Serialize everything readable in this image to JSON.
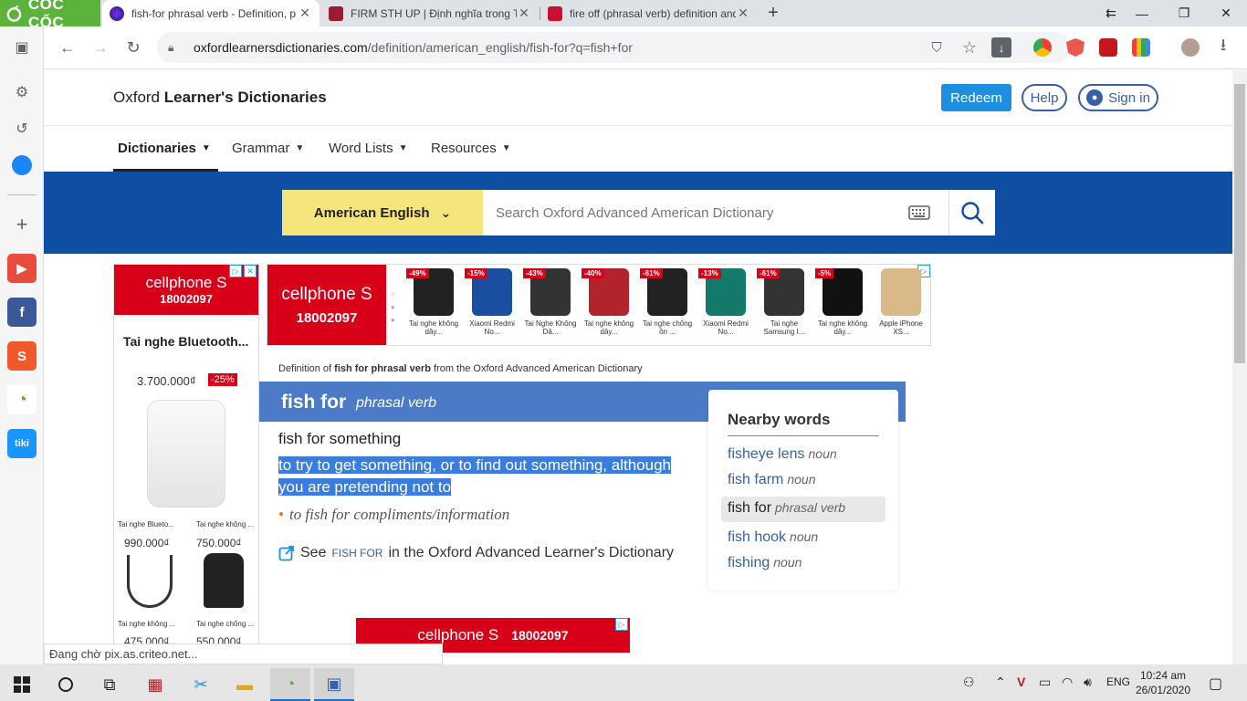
{
  "browser": {
    "logo_text": "CỐC CỐC",
    "tabs": [
      {
        "title": "fish-for phrasal verb - Definition, p",
        "active": true
      },
      {
        "title": "FIRM STH UP | Định nghĩa trong T",
        "active": false
      },
      {
        "title": "fire off (phrasal verb) definition and",
        "active": false
      }
    ],
    "url_host": "oxfordlearnersdictionaries.com",
    "url_path": "/definition/american_english/fish-for?q=fish+for",
    "status_text": "Đang chờ pix.as.criteo.net..."
  },
  "site": {
    "logo_prefix": "Oxford ",
    "logo_bold": "Learner's Dictionaries",
    "redeem": "Redeem",
    "help": "Help",
    "signin": "Sign in",
    "nav": [
      "Dictionaries",
      "Grammar",
      "Word Lists",
      "Resources"
    ]
  },
  "search": {
    "dictionary": "American English",
    "placeholder": "Search Oxford Advanced American Dictionary"
  },
  "ads": {
    "brand": "cellphone S",
    "phone": "18002097",
    "left_title": "Tai nghe Bluetooth...",
    "left_price": "3.700.000₫",
    "left_discount": "-25%",
    "left_items": [
      {
        "name": "Tai nghe Blueto...",
        "price": "990.000₫"
      },
      {
        "name": "Tai nghe không ...",
        "price": "750.000₫"
      },
      {
        "name": "Tai nghe không ...",
        "price": "475.000₫"
      },
      {
        "name": "Tai nghe chống ...",
        "price": "550.000₫"
      }
    ],
    "top_products": [
      {
        "disc": "-49%",
        "name": "Tai nghe không dây...",
        "color": "#222"
      },
      {
        "disc": "-15%",
        "name": "Xiaomi Redmi No...",
        "color": "#1a4fa0"
      },
      {
        "disc": "-43%",
        "name": "Tai Nghe Không Dâ...",
        "color": "#333"
      },
      {
        "disc": "-40%",
        "name": "Tai nghe không dây...",
        "color": "#b3232b"
      },
      {
        "disc": "-61%",
        "name": "Tai nghe chống ồn ...",
        "color": "#222"
      },
      {
        "disc": "-13%",
        "name": "Xiaomi Redmi No...",
        "color": "#137a6b"
      },
      {
        "disc": "-61%",
        "name": "Tai nghe Samsung I...",
        "color": "#333"
      },
      {
        "disc": "-5%",
        "name": "Tai nghe không dây...",
        "color": "#111"
      },
      {
        "disc": "",
        "name": "Apple iPhone XS...",
        "color": "#d9b98a"
      }
    ]
  },
  "entry": {
    "source_prefix": "Definition of ",
    "source_word": "fish for phrasal verb",
    "source_suffix": " from the Oxford Advanced American Dictionary",
    "headword": "fish for",
    "pos": "phrasal verb",
    "pattern": "fish for something",
    "definition_line1": "to try to get something, or to find out something, although",
    "definition_line2": "you are pretending not to",
    "example": "to fish for compliments/information",
    "see_prefix": "See ",
    "see_word": "FISH FOR",
    "see_suffix": " in the Oxford Advanced Learner's Dictionary"
  },
  "nearby": {
    "title": "Nearby words",
    "items": [
      {
        "word": "fisheye lens",
        "pos": "noun"
      },
      {
        "word": "fish farm",
        "pos": "noun"
      },
      {
        "word": "fish for",
        "pos": "phrasal verb"
      },
      {
        "word": "fish hook",
        "pos": "noun"
      },
      {
        "word": "fishing",
        "pos": "noun"
      }
    ]
  },
  "taskbar": {
    "lang": "ENG",
    "time": "10:24 am",
    "date": "26/01/2020"
  },
  "colors": {
    "band": "#0f4fa3",
    "headword_bar": "#4b7bc7",
    "dict_select": "#f5e57c",
    "selection": "#3a7de0",
    "ad_red": "#d70018"
  }
}
